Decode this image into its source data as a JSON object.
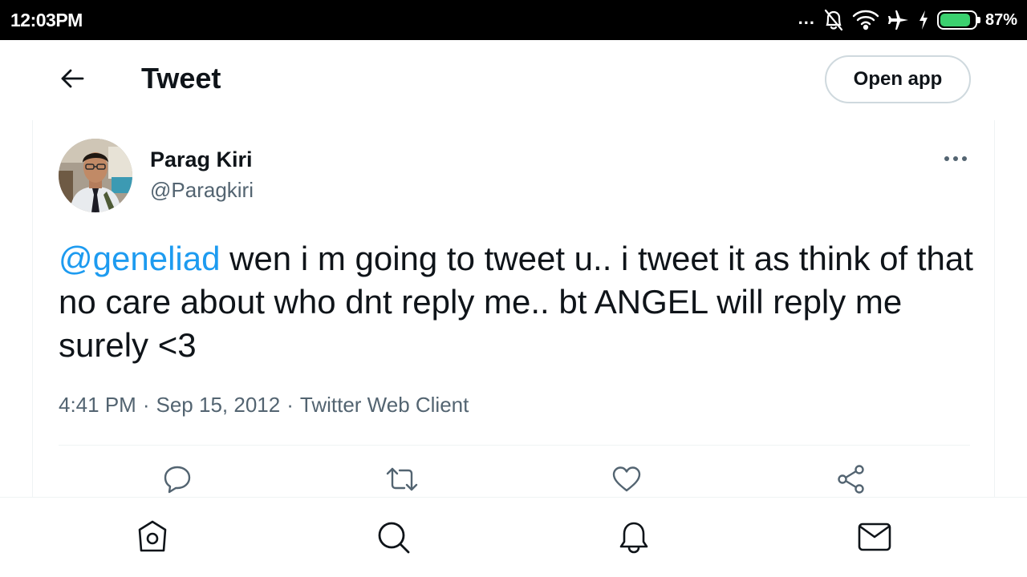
{
  "status_bar": {
    "time": "12:03PM",
    "overflow": "...",
    "battery_percent": "87%",
    "battery_level": 0.87,
    "battery_color": "#3bd16f",
    "icons": [
      "notifications-off-icon",
      "wifi-icon",
      "airplane-mode-icon",
      "charging-bolt-icon",
      "battery-icon"
    ]
  },
  "header": {
    "back_icon": "arrow-left-icon",
    "title": "Tweet",
    "open_app_label": "Open app"
  },
  "tweet": {
    "author": {
      "name": "Parag Kiri",
      "handle": "@Paragkiri"
    },
    "more_icon": "more-horizontal-icon",
    "mention": "@geneliad",
    "text": " wen i m going to tweet u.. i tweet it as think of that no care about who dnt reply me.. bt ANGEL will reply me surely <3",
    "time": "4:41 PM",
    "separator": "·",
    "date": "Sep 15, 2012",
    "source": "Twitter Web Client",
    "actions": [
      "reply-icon",
      "retweet-icon",
      "like-icon",
      "share-icon"
    ]
  },
  "bottom_nav": [
    "home-icon",
    "search-icon",
    "notifications-icon",
    "messages-icon"
  ],
  "colors": {
    "accent": "#1d9bf0",
    "text": "#0f1419",
    "secondary_text": "#536471",
    "border": "#cfd9de"
  }
}
